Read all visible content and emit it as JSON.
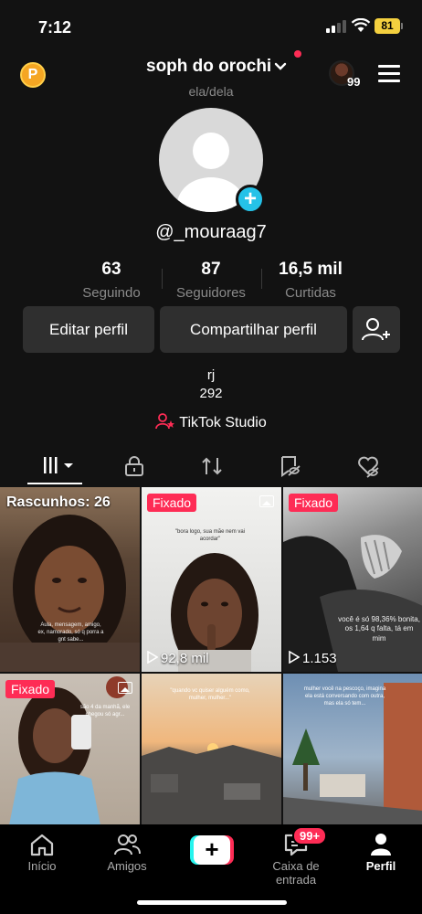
{
  "status_bar": {
    "time": "7:12",
    "battery": "81"
  },
  "header": {
    "coin_label": "P",
    "username": "soph do orochi",
    "pronouns": "ela/dela",
    "story_count": "99"
  },
  "profile": {
    "handle": "@_mouraag7",
    "stats": [
      {
        "value": "63",
        "label": "Seguindo"
      },
      {
        "value": "87",
        "label": "Seguidores"
      },
      {
        "value": "16,5 mil",
        "label": "Curtidas"
      }
    ],
    "edit_button": "Editar perfil",
    "share_button": "Compartilhar perfil",
    "bio_line1": "rj",
    "bio_line2": "292",
    "studio_link": "TikTok Studio"
  },
  "grid": [
    {
      "draft_label": "Rascunhos: 26",
      "caption": "Aula, mensagem, amigo, ex, namorado, só q porra a gnt sabe..."
    },
    {
      "badge": "Fixado",
      "views": "92,8 mil",
      "caption": "\"bora logo, sua mãe nem vai acordar\""
    },
    {
      "badge": "Fixado",
      "views": "1.153",
      "caption": "você é só 98,36% bonita, os 1,64 q falta, tá em mim"
    },
    {
      "badge": "Fixado",
      "caption": "são 4 da manhã, ele chegou só agr..."
    },
    {
      "caption": "\"quando vc quiser alguém como, mulher, mulher...\""
    },
    {
      "caption": "mulher você na pescoço, imagina ela está conversando com outra, mas ela só tem..."
    }
  ],
  "nav": {
    "home": "Início",
    "friends": "Amigos",
    "create": "+",
    "inbox": "Caixa de entrada",
    "inbox_badge": "99+",
    "profile": "Perfil"
  },
  "colors": {
    "accent": "#fe2c55",
    "cyan": "#25f4ee",
    "bg": "#121212",
    "button_bg": "#2f2f2f"
  }
}
